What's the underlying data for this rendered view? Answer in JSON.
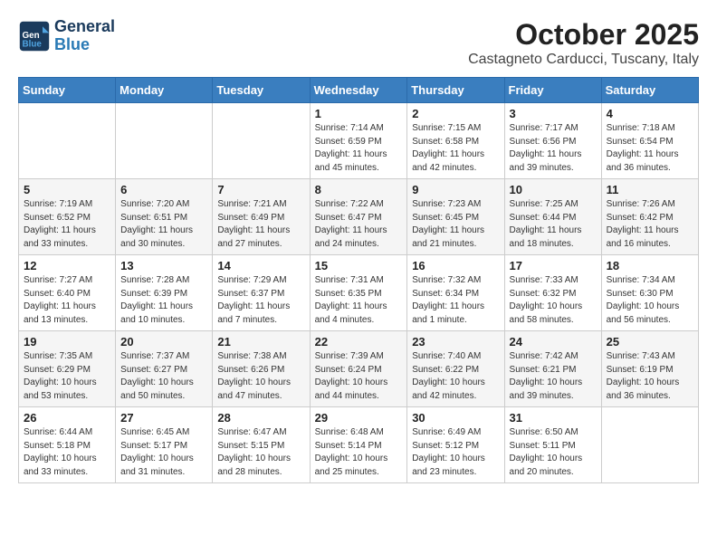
{
  "header": {
    "logo_general": "General",
    "logo_blue": "Blue",
    "title": "October 2025",
    "subtitle": "Castagneto Carducci, Tuscany, Italy"
  },
  "calendar": {
    "days_of_week": [
      "Sunday",
      "Monday",
      "Tuesday",
      "Wednesday",
      "Thursday",
      "Friday",
      "Saturday"
    ],
    "weeks": [
      [
        {
          "day": "",
          "info": ""
        },
        {
          "day": "",
          "info": ""
        },
        {
          "day": "",
          "info": ""
        },
        {
          "day": "1",
          "info": "Sunrise: 7:14 AM\nSunset: 6:59 PM\nDaylight: 11 hours\nand 45 minutes."
        },
        {
          "day": "2",
          "info": "Sunrise: 7:15 AM\nSunset: 6:58 PM\nDaylight: 11 hours\nand 42 minutes."
        },
        {
          "day": "3",
          "info": "Sunrise: 7:17 AM\nSunset: 6:56 PM\nDaylight: 11 hours\nand 39 minutes."
        },
        {
          "day": "4",
          "info": "Sunrise: 7:18 AM\nSunset: 6:54 PM\nDaylight: 11 hours\nand 36 minutes."
        }
      ],
      [
        {
          "day": "5",
          "info": "Sunrise: 7:19 AM\nSunset: 6:52 PM\nDaylight: 11 hours\nand 33 minutes."
        },
        {
          "day": "6",
          "info": "Sunrise: 7:20 AM\nSunset: 6:51 PM\nDaylight: 11 hours\nand 30 minutes."
        },
        {
          "day": "7",
          "info": "Sunrise: 7:21 AM\nSunset: 6:49 PM\nDaylight: 11 hours\nand 27 minutes."
        },
        {
          "day": "8",
          "info": "Sunrise: 7:22 AM\nSunset: 6:47 PM\nDaylight: 11 hours\nand 24 minutes."
        },
        {
          "day": "9",
          "info": "Sunrise: 7:23 AM\nSunset: 6:45 PM\nDaylight: 11 hours\nand 21 minutes."
        },
        {
          "day": "10",
          "info": "Sunrise: 7:25 AM\nSunset: 6:44 PM\nDaylight: 11 hours\nand 18 minutes."
        },
        {
          "day": "11",
          "info": "Sunrise: 7:26 AM\nSunset: 6:42 PM\nDaylight: 11 hours\nand 16 minutes."
        }
      ],
      [
        {
          "day": "12",
          "info": "Sunrise: 7:27 AM\nSunset: 6:40 PM\nDaylight: 11 hours\nand 13 minutes."
        },
        {
          "day": "13",
          "info": "Sunrise: 7:28 AM\nSunset: 6:39 PM\nDaylight: 11 hours\nand 10 minutes."
        },
        {
          "day": "14",
          "info": "Sunrise: 7:29 AM\nSunset: 6:37 PM\nDaylight: 11 hours\nand 7 minutes."
        },
        {
          "day": "15",
          "info": "Sunrise: 7:31 AM\nSunset: 6:35 PM\nDaylight: 11 hours\nand 4 minutes."
        },
        {
          "day": "16",
          "info": "Sunrise: 7:32 AM\nSunset: 6:34 PM\nDaylight: 11 hours\nand 1 minute."
        },
        {
          "day": "17",
          "info": "Sunrise: 7:33 AM\nSunset: 6:32 PM\nDaylight: 10 hours\nand 58 minutes."
        },
        {
          "day": "18",
          "info": "Sunrise: 7:34 AM\nSunset: 6:30 PM\nDaylight: 10 hours\nand 56 minutes."
        }
      ],
      [
        {
          "day": "19",
          "info": "Sunrise: 7:35 AM\nSunset: 6:29 PM\nDaylight: 10 hours\nand 53 minutes."
        },
        {
          "day": "20",
          "info": "Sunrise: 7:37 AM\nSunset: 6:27 PM\nDaylight: 10 hours\nand 50 minutes."
        },
        {
          "day": "21",
          "info": "Sunrise: 7:38 AM\nSunset: 6:26 PM\nDaylight: 10 hours\nand 47 minutes."
        },
        {
          "day": "22",
          "info": "Sunrise: 7:39 AM\nSunset: 6:24 PM\nDaylight: 10 hours\nand 44 minutes."
        },
        {
          "day": "23",
          "info": "Sunrise: 7:40 AM\nSunset: 6:22 PM\nDaylight: 10 hours\nand 42 minutes."
        },
        {
          "day": "24",
          "info": "Sunrise: 7:42 AM\nSunset: 6:21 PM\nDaylight: 10 hours\nand 39 minutes."
        },
        {
          "day": "25",
          "info": "Sunrise: 7:43 AM\nSunset: 6:19 PM\nDaylight: 10 hours\nand 36 minutes."
        }
      ],
      [
        {
          "day": "26",
          "info": "Sunrise: 6:44 AM\nSunset: 5:18 PM\nDaylight: 10 hours\nand 33 minutes."
        },
        {
          "day": "27",
          "info": "Sunrise: 6:45 AM\nSunset: 5:17 PM\nDaylight: 10 hours\nand 31 minutes."
        },
        {
          "day": "28",
          "info": "Sunrise: 6:47 AM\nSunset: 5:15 PM\nDaylight: 10 hours\nand 28 minutes."
        },
        {
          "day": "29",
          "info": "Sunrise: 6:48 AM\nSunset: 5:14 PM\nDaylight: 10 hours\nand 25 minutes."
        },
        {
          "day": "30",
          "info": "Sunrise: 6:49 AM\nSunset: 5:12 PM\nDaylight: 10 hours\nand 23 minutes."
        },
        {
          "day": "31",
          "info": "Sunrise: 6:50 AM\nSunset: 5:11 PM\nDaylight: 10 hours\nand 20 minutes."
        },
        {
          "day": "",
          "info": ""
        }
      ]
    ]
  }
}
